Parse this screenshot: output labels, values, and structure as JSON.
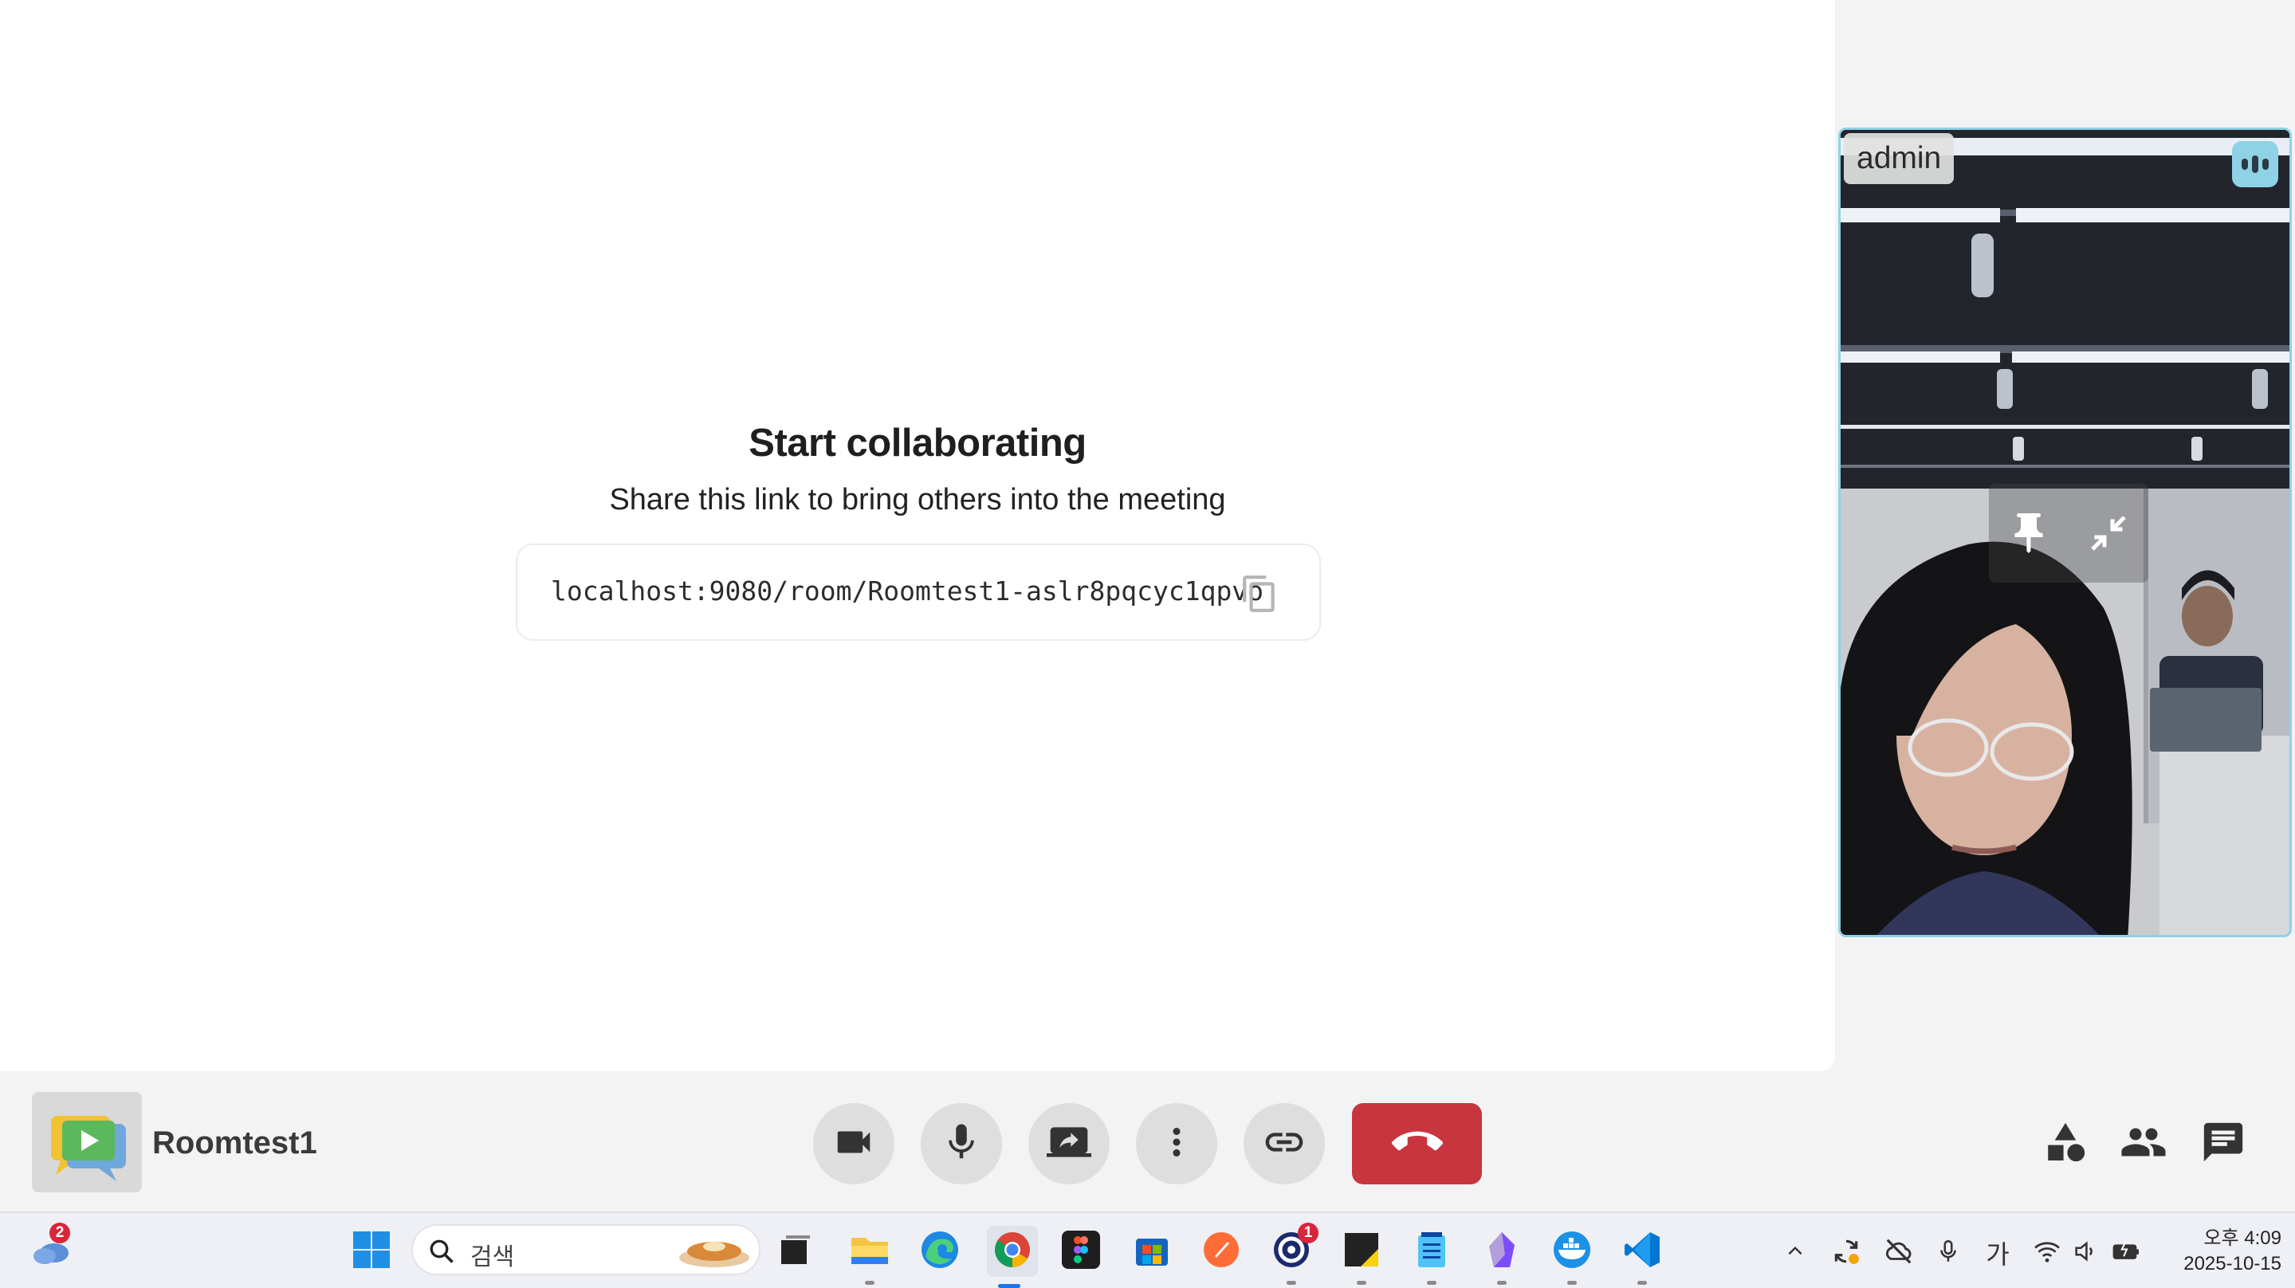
{
  "invite": {
    "title": "Start collaborating",
    "subtitle": "Share this link to bring others into the meeting",
    "link": "localhost:9080/room/Roomtest1-aslr8pqcyc1qpvo"
  },
  "participant": {
    "name": "admin"
  },
  "room": {
    "name": "Roomtest1"
  },
  "controls": {
    "hangup_color": "#c9353f",
    "accent": "#8fd2e6"
  },
  "taskbar": {
    "search_placeholder": "검색",
    "weather_badge": "2",
    "notify_badge": "1",
    "ime_label": "가",
    "time": "오후 4:09",
    "date": "2025-10-15"
  }
}
